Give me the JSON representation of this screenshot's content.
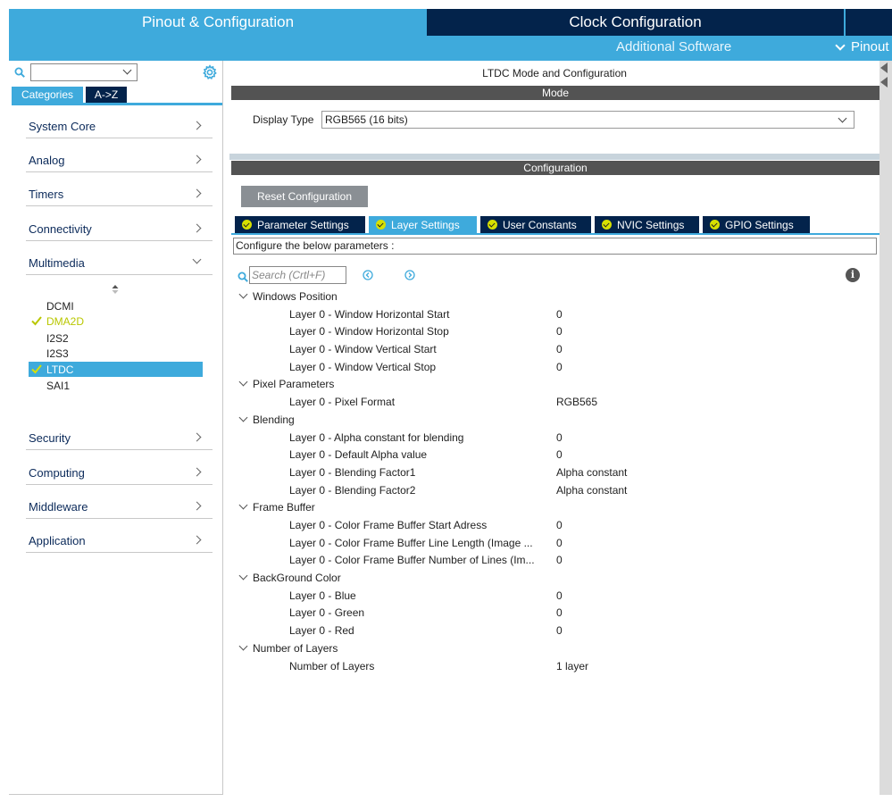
{
  "header": {
    "tab_pinout": "Pinout & Configuration",
    "tab_clock": "Clock Configuration",
    "additional_software": "Additional Software",
    "pinout_menu": "Pinout"
  },
  "left": {
    "search_value": "",
    "tab_categories": "Categories",
    "tab_az": "A->Z",
    "categories_top": [
      {
        "label": "System Core"
      },
      {
        "label": "Analog"
      },
      {
        "label": "Timers"
      },
      {
        "label": "Connectivity"
      },
      {
        "label": "Multimedia"
      }
    ],
    "multimedia_items": [
      {
        "label": "DCMI",
        "checked": false,
        "selected": false
      },
      {
        "label": "DMA2D",
        "checked": true,
        "selected": false
      },
      {
        "label": "I2S2",
        "checked": false,
        "selected": false
      },
      {
        "label": "I2S3",
        "checked": false,
        "selected": false
      },
      {
        "label": "LTDC",
        "checked": true,
        "selected": true
      },
      {
        "label": "SAI1",
        "checked": false,
        "selected": false
      }
    ],
    "categories_bottom": [
      {
        "label": "Security"
      },
      {
        "label": "Computing"
      },
      {
        "label": "Middleware"
      },
      {
        "label": "Application"
      }
    ]
  },
  "right": {
    "title": "LTDC Mode and Configuration",
    "mode_header": "Mode",
    "display_type_label": "Display Type",
    "display_type_value": "RGB565 (16 bits)",
    "configuration_header": "Configuration",
    "reset_button": "Reset Configuration",
    "tabs": [
      {
        "label": "Parameter Settings"
      },
      {
        "label": "Layer Settings"
      },
      {
        "label": "User Constants"
      },
      {
        "label": "NVIC Settings"
      },
      {
        "label": "GPIO Settings"
      }
    ],
    "active_tab": "Layer Settings",
    "configure_text": "Configure the below parameters :",
    "search_placeholder": "Search (Crtl+F)",
    "groups": [
      {
        "name": "Windows Position",
        "params": [
          {
            "name": "Layer 0 - Window Horizontal Start",
            "value": "0"
          },
          {
            "name": "Layer 0 - Window Horizontal Stop",
            "value": "0"
          },
          {
            "name": "Layer 0 - Window Vertical Start",
            "value": "0"
          },
          {
            "name": "Layer 0 - Window Vertical Stop",
            "value": "0"
          }
        ]
      },
      {
        "name": "Pixel Parameters",
        "params": [
          {
            "name": "Layer 0 - Pixel Format",
            "value": "RGB565"
          }
        ]
      },
      {
        "name": "Blending",
        "params": [
          {
            "name": "Layer 0 - Alpha constant for blending",
            "value": "0"
          },
          {
            "name": "Layer 0 - Default Alpha value",
            "value": "0"
          },
          {
            "name": "Layer 0 - Blending Factor1",
            "value": "Alpha constant"
          },
          {
            "name": "Layer 0 - Blending Factor2",
            "value": "Alpha constant"
          }
        ]
      },
      {
        "name": "Frame Buffer",
        "params": [
          {
            "name": "Layer 0 - Color Frame Buffer Start Adress",
            "value": "0"
          },
          {
            "name": "Layer 0 - Color Frame Buffer Line Length (Image ...",
            "value": "0"
          },
          {
            "name": "Layer 0 - Color Frame Buffer Number of Lines (Im...",
            "value": "0"
          }
        ]
      },
      {
        "name": "BackGround Color",
        "params": [
          {
            "name": "Layer 0 - Blue",
            "value": "0"
          },
          {
            "name": "Layer 0 - Green",
            "value": "0"
          },
          {
            "name": "Layer 0 - Red",
            "value": "0"
          }
        ]
      },
      {
        "name": "Number of Layers",
        "params": [
          {
            "name": "Number of Layers",
            "value": "1 layer"
          }
        ]
      }
    ]
  },
  "colors": {
    "accent_blue": "#3eaadc",
    "navy": "#03234b",
    "section_gray": "#535353",
    "check_yellow": "#d7e000"
  }
}
